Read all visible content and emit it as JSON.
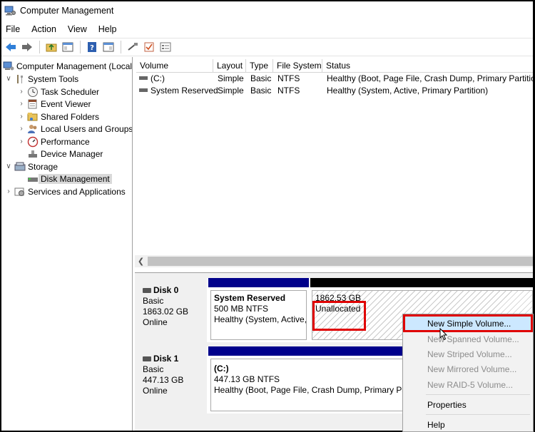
{
  "window": {
    "title": "Computer Management"
  },
  "menu": [
    "File",
    "Action",
    "View",
    "Help"
  ],
  "tree": {
    "root": "Computer Management (Local",
    "system_tools": "System Tools",
    "task_scheduler": "Task Scheduler",
    "event_viewer": "Event Viewer",
    "shared_folders": "Shared Folders",
    "local_users": "Local Users and Groups",
    "performance": "Performance",
    "device_manager": "Device Manager",
    "storage": "Storage",
    "disk_management": "Disk Management",
    "services": "Services and Applications"
  },
  "volume_list": {
    "columns": [
      "Volume",
      "Layout",
      "Type",
      "File System",
      "Status"
    ],
    "rows": [
      {
        "volume": "(C:)",
        "layout": "Simple",
        "type": "Basic",
        "fs": "NTFS",
        "status": "Healthy (Boot, Page File, Crash Dump, Primary Partition)"
      },
      {
        "volume": "System Reserved",
        "layout": "Simple",
        "type": "Basic",
        "fs": "NTFS",
        "status": "Healthy (System, Active, Primary Partition)"
      }
    ]
  },
  "disks": [
    {
      "name": "Disk 0",
      "type": "Basic",
      "size": "1863.02 GB",
      "state": "Online",
      "partitions": [
        {
          "name": "System Reserved",
          "size": "500 MB NTFS",
          "status": "Healthy (System, Active,"
        },
        {
          "size": "1862.53 GB",
          "status": "Unallocated"
        }
      ]
    },
    {
      "name": "Disk 1",
      "type": "Basic",
      "size": "447.13 GB",
      "state": "Online",
      "partitions": [
        {
          "name": "(C:)",
          "size": "447.13 GB NTFS",
          "status": "Healthy (Boot, Page File, Crash Dump, Primary Partit"
        }
      ]
    }
  ],
  "context_menu": {
    "new_simple": "New Simple Volume...",
    "new_spanned": "New Spanned Volume...",
    "new_striped": "New Striped Volume...",
    "new_mirrored": "New Mirrored Volume...",
    "new_raid5": "New RAID-5 Volume...",
    "properties": "Properties",
    "help": "Help"
  },
  "colors": {
    "primary_partition_bar": "#00008b",
    "unallocated_bar": "#000000",
    "highlight": "#e00000"
  }
}
